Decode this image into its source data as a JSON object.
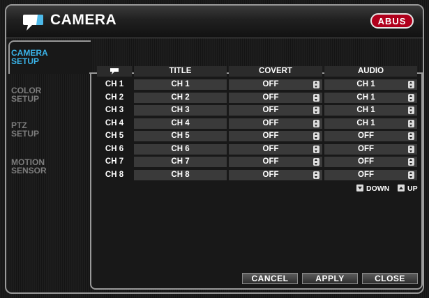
{
  "window": {
    "title": "CAMERA",
    "brand": "ABUS",
    "brand_color": "#b0001c",
    "accent": "#3ab3e8"
  },
  "sidebar": {
    "items": [
      {
        "line1": "CAMERA",
        "line2": "SETUP",
        "active": true
      },
      {
        "line1": "COLOR",
        "line2": "SETUP",
        "active": false
      },
      {
        "line1": "PTZ",
        "line2": "SETUP",
        "active": false
      },
      {
        "line1": "MOTION",
        "line2": "SENSOR",
        "active": false
      }
    ]
  },
  "table": {
    "header_icon": "speech-bubble-icon",
    "headers": {
      "title": "TITLE",
      "covert": "COVERT",
      "audio": "AUDIO"
    },
    "rows": [
      {
        "ch": "CH 1",
        "title": "CH 1",
        "covert": "OFF",
        "audio": "CH 1"
      },
      {
        "ch": "CH 2",
        "title": "CH 2",
        "covert": "OFF",
        "audio": "CH 1"
      },
      {
        "ch": "CH 3",
        "title": "CH 3",
        "covert": "OFF",
        "audio": "CH 1"
      },
      {
        "ch": "CH 4",
        "title": "CH 4",
        "covert": "OFF",
        "audio": "CH 1"
      },
      {
        "ch": "CH 5",
        "title": "CH 5",
        "covert": "OFF",
        "audio": "OFF"
      },
      {
        "ch": "CH 6",
        "title": "CH 6",
        "covert": "OFF",
        "audio": "OFF"
      },
      {
        "ch": "CH 7",
        "title": "CH 7",
        "covert": "OFF",
        "audio": "OFF"
      },
      {
        "ch": "CH 8",
        "title": "CH 8",
        "covert": "OFF",
        "audio": "OFF"
      }
    ]
  },
  "legend": {
    "down": "DOWN",
    "up": "UP"
  },
  "buttons": {
    "cancel": "CANCEL",
    "apply": "APPLY",
    "close": "CLOSE"
  }
}
